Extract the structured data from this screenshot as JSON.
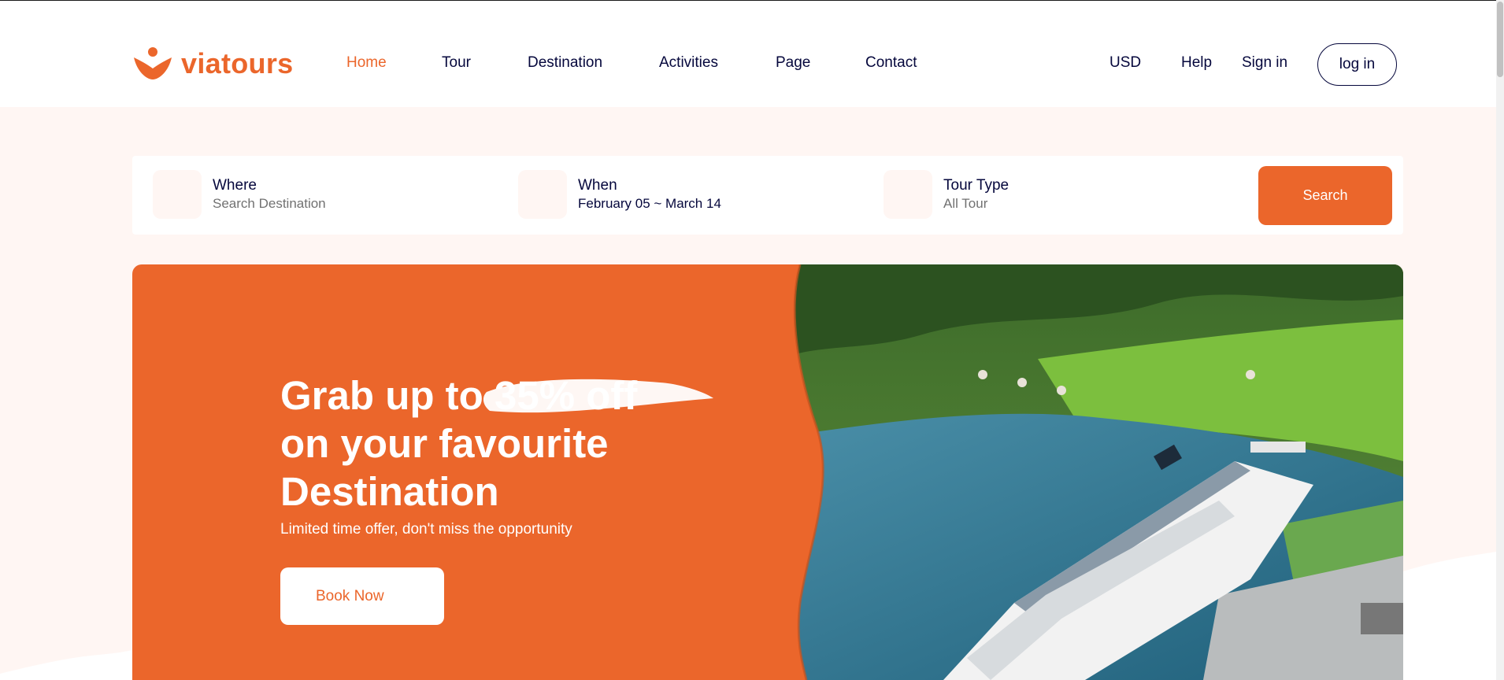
{
  "brand": {
    "name": "viatours",
    "color": "#eb662b"
  },
  "nav": {
    "items": [
      {
        "label": "Home",
        "active": true
      },
      {
        "label": "Tour",
        "active": false
      },
      {
        "label": "Destination",
        "active": false
      },
      {
        "label": "Activities",
        "active": false
      },
      {
        "label": "Page",
        "active": false
      },
      {
        "label": "Contact",
        "active": false
      }
    ]
  },
  "header_right": {
    "currency": "USD",
    "help": "Help",
    "signin": "Sign in",
    "login": "log in"
  },
  "search": {
    "where": {
      "label": "Where",
      "value": "Search Destination",
      "icon": "location-icon"
    },
    "when": {
      "label": "When",
      "value": "February 05 ~ March 14",
      "icon": "calendar-icon"
    },
    "tour_type": {
      "label": "Tour Type",
      "value": "All Tour",
      "icon": "tour-type-icon"
    },
    "button": "Search"
  },
  "hero": {
    "title_part1": "Grab up to ",
    "title_highlight": "35% off",
    "title_part2": "on your favourite Destination",
    "subtitle": "Limited time offer, don't miss the opportunity",
    "cta": "Book Now",
    "image": "cruise-ship-fjord-image"
  }
}
